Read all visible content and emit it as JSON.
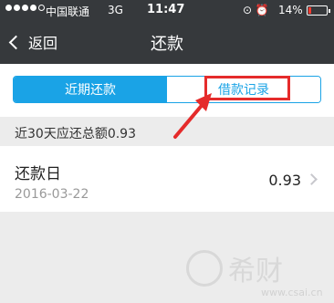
{
  "status_bar": {
    "carrier": "中国联通",
    "network": "3G",
    "time": "11:47",
    "battery": "14%"
  },
  "nav": {
    "back_label": "返回",
    "title": "还款"
  },
  "tabs": [
    {
      "label": "近期还款",
      "active": true
    },
    {
      "label": "借款记录",
      "active": false
    }
  ],
  "summary_text": "近30天应还总额0.93",
  "repayment_item": {
    "title": "还款日",
    "date": "2016-03-22",
    "amount": "0.93"
  },
  "watermark": {
    "text": "希财",
    "url": "www.csai.cn"
  },
  "colors": {
    "header_bg": "#36393c",
    "accent": "#1aa3e6",
    "annotation": "#e52b2b"
  }
}
